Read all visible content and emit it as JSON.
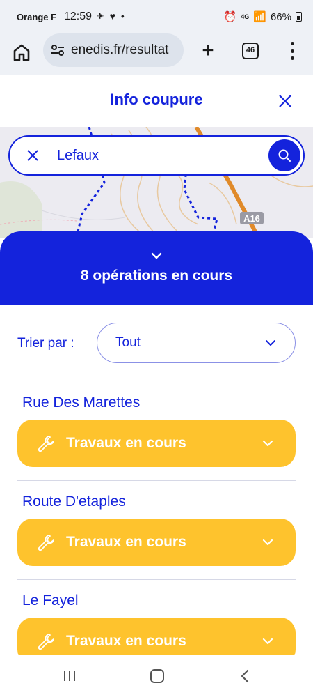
{
  "status_bar": {
    "carrier": "Orange F",
    "time": "12:59",
    "notifications": "✈ ♥ •",
    "network": "4G",
    "battery": "66%"
  },
  "browser": {
    "url": "enedis.fr/resultat",
    "tab_count": "46"
  },
  "modal": {
    "title": "Info coupure"
  },
  "search": {
    "value": "Lefaux"
  },
  "operations_panel": {
    "count_label": "8 opérations en cours"
  },
  "sort": {
    "label": "Trier par :",
    "selected": "Tout"
  },
  "operations": [
    {
      "street": "Rue Des Marettes",
      "status": "Travaux en cours"
    },
    {
      "street": "Route D'etaples",
      "status": "Travaux en cours"
    },
    {
      "street": "Le Fayel",
      "status": "Travaux en cours"
    }
  ],
  "map": {
    "road_label": "A16"
  },
  "colors": {
    "brand_blue": "#1423dc",
    "status_yellow": "#fec32d",
    "map_background": "#ecebf1",
    "road_orange": "#e08a2a"
  }
}
